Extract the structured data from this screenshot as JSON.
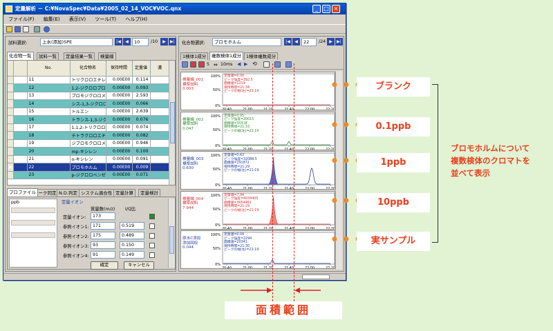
{
  "window": {
    "title": "定量解析 － C:¥NovaSpec¥Data¥2005_02_14_VOC¥VOC.qnx",
    "controls": [
      "_",
      "□",
      "×"
    ]
  },
  "menu": [
    "ファイル(F)",
    "編集(E)",
    "表示(V)",
    "ツール(T)",
    "ヘルプ(H)"
  ],
  "left_panel": {
    "sample_select_label": "試料選択:",
    "sample_value": "上水(添加)SPE",
    "page_current": "10",
    "page_total": "/10",
    "tabs": [
      "化合物一覧",
      "試料一覧",
      "定量結果一覧",
      "検量線"
    ],
    "columns": [
      "No.",
      "化合物名",
      "保持時間",
      "定量値",
      "濃"
    ],
    "rows": [
      {
        "no": "11",
        "name": "トリクロロエチレン",
        "rt": "0.00E00",
        "val": "0.114",
        "style": "white"
      },
      {
        "no": "12",
        "name": "1,2-ジクロロプロパン",
        "rt": "0.00E00",
        "val": "0.093",
        "style": "teal"
      },
      {
        "no": "13",
        "name": "ブロモジクロロメタン",
        "rt": "0.00E00",
        "val": "2.593",
        "style": "white"
      },
      {
        "no": "14",
        "name": "シス-1,3-ジクロロ...",
        "rt": "0.00E00",
        "val": "0.066",
        "style": "teal"
      },
      {
        "no": "15",
        "name": "トルエン",
        "rt": "0.00E00",
        "val": "2.639",
        "style": "white"
      },
      {
        "no": "16",
        "name": "トランス-1,3-ジクロ...",
        "rt": "0.00E00",
        "val": "0.076",
        "style": "teal"
      },
      {
        "no": "17",
        "name": "1,1,2-トリクロロエタ...",
        "rt": "0.00E00",
        "val": "0.074",
        "style": "white"
      },
      {
        "no": "18",
        "name": "テトラクロロエチレン",
        "rt": "0.00E00",
        "val": "0.082",
        "style": "teal"
      },
      {
        "no": "19",
        "name": "ジブロモクロロメタン",
        "rt": "0.00E00",
        "val": "0.946",
        "style": "white"
      },
      {
        "no": "20",
        "name": "mp-キシレン",
        "rt": "0.00E00",
        "val": "0.100",
        "style": "teal"
      },
      {
        "no": "21",
        "name": "o-キシレン",
        "rt": "0.00E00",
        "val": "0.091",
        "style": "white"
      },
      {
        "no": "22",
        "name": "ブロモホルム",
        "rt": "0.00E00",
        "val": "0.009",
        "style": "sel"
      },
      {
        "no": "23",
        "name": "p-ジクロロベンゼン",
        "rt": "0.00E00",
        "val": "0.071",
        "style": "teal"
      }
    ],
    "bottom_tabs": [
      "プロファイル",
      "ピーク同定",
      "N.D.判定",
      "システム適合性",
      "定量計算",
      "定量検討"
    ],
    "group_label": "定量イオン",
    "col_mass": "質量数(m/z)",
    "col_ratio": "I/Q比",
    "ions": [
      {
        "label": "定量イオン:",
        "mass": "173",
        "ratio": "",
        "checked": true
      },
      {
        "label": "参照イオン1:",
        "mass": "171",
        "ratio": "0.519",
        "checked": false
      },
      {
        "label": "参照イオン2:",
        "mass": "175",
        "ratio": "0.489",
        "checked": false
      },
      {
        "label": "参照イオン3:",
        "mass": "93",
        "ratio": "0.150",
        "checked": false
      },
      {
        "label": "参照イオン4:",
        "mass": "91",
        "ratio": "0.149",
        "checked": false
      }
    ],
    "profile_stub": "ppb",
    "ok_button": "確定",
    "cancel_button": "キャンセル"
  },
  "right_panel": {
    "compound_select_label": "化合物選択:",
    "compound_value": "ブロモホルム",
    "page_current": "22",
    "page_total": "/24",
    "tabs": [
      "1検体1成分",
      "複数検体1成分",
      "1検体複数成分"
    ],
    "toolbar_value": "5",
    "toolbar_time": "10ms",
    "x_ticks": [
      "20:40",
      "21:00",
      "21:20",
      "21:40",
      "22:00",
      "22:20"
    ],
    "y_ticks": [
      "100%",
      "50%",
      "0%"
    ],
    "chromatograms": [
      {
        "side": "検量線_001\n標準試料\n0.003",
        "side_color": "#d03030",
        "anno": "定量値=0.00\nピーク強度=392.5\n面積値=1219\n保持時間=21:34\nピークの幅(左)=21:19",
        "anno_color": "#d03030",
        "line_color": "#d03030",
        "peak_at": 21.98,
        "peak_h": 0.85,
        "small_peaks": [],
        "fill_at": null
      },
      {
        "side": "検量線_002\n標準試料\n0.047",
        "side_color": "#2a8a2a",
        "anno": "定量値=0.05\nピーク強度=20015\n面積値=30318\n保持時間=21:33\nピークの幅(左)=21:19",
        "anno_color": "#2a8a2a",
        "line_color": "#2a8a2a",
        "peak_at": 21.98,
        "peak_h": 0.75,
        "small_peaks": [
          21.24,
          21.4
        ],
        "fill_at": null
      },
      {
        "side": "検量線_003\n標準試料\n0.630",
        "side_color": "#203c9c",
        "anno": "定量値=0.63\nピーク強度=32088.5\n面積値=291872\n保持時間=21:29\nピークの幅(左)=21:19",
        "anno_color": "#203c9c",
        "line_color": "#203c9c",
        "peak_at": 22.02,
        "peak_h": 0.55,
        "small_peaks": [],
        "fill_at": 21.25,
        "fill_color": "#5a6cd0",
        "fill_h": 0.92
      },
      {
        "side": "検量線_004\n標準試料\n7.944",
        "side_color": "#d03030",
        "anno": "定量値=7.94\nピーク強度=4034405\n面積値=3654462\n保持時間=21:29\nピークの幅(左)=21:19",
        "anno_color": "#d03030",
        "line_color": "#d03030",
        "peak_at": null,
        "peak_h": 0,
        "small_peaks": [],
        "fill_at": 21.25,
        "fill_color": "#f08878",
        "fill_h": 0.95
      },
      {
        "side": "原水C添加\n添加回収\n0.044",
        "side_color": "#203c9c",
        "anno": "定量値=0.04\nピーク強度=2294\n面積値=20341\n保持時間=21:30\nピークの幅(左)=21:19",
        "anno_color": "#203c9c",
        "line_color": "#203c9c",
        "peak_at": 21.95,
        "peak_h": 0.55,
        "small_peaks": [
          21.24
        ],
        "fill_at": null
      }
    ]
  },
  "callouts": [
    "ブランク",
    "0.1ppb",
    "1ppb",
    "10ppb",
    "実サンプル"
  ],
  "dots": "● ● ●",
  "side_note": [
    "ブロモホルムについて",
    "複数検体のクロマトを",
    "並べて表示"
  ],
  "area_label": "面積範囲",
  "colors": {
    "background": "#e2f3d4",
    "accent": "#e8401c",
    "dot": "#f08a24",
    "teal_row": "#6cc0c0",
    "selected_row": "#1e3c9c"
  }
}
